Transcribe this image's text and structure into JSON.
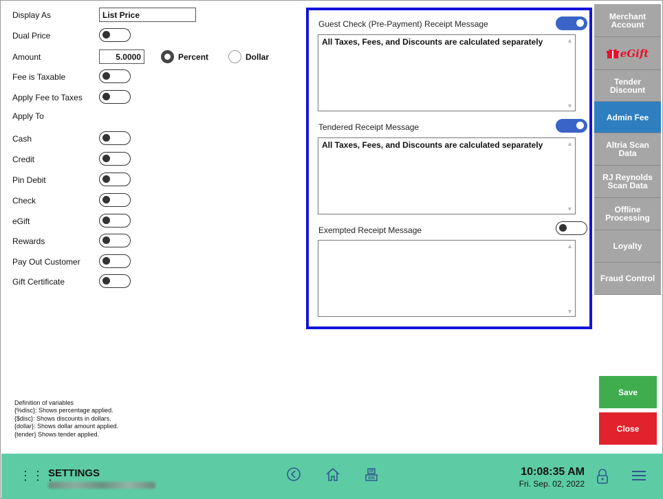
{
  "left": {
    "display_as": {
      "label": "Display As",
      "value": "List Price"
    },
    "dual_price": {
      "label": "Dual Price",
      "on": false
    },
    "amount": {
      "label": "Amount",
      "value": "5.0000",
      "percent_label": "Percent",
      "dollar_label": "Dollar",
      "selected": "percent"
    },
    "fee_taxable": {
      "label": "Fee is Taxable",
      "on": false
    },
    "apply_fee_taxes": {
      "label": "Apply Fee to Taxes",
      "on": false
    },
    "apply_to_label": "Apply To",
    "tenders": [
      {
        "label": "Cash",
        "on": false
      },
      {
        "label": "Credit",
        "on": false
      },
      {
        "label": "Pin Debit",
        "on": false
      },
      {
        "label": "Check",
        "on": false
      },
      {
        "label": "eGift",
        "on": false
      },
      {
        "label": "Rewards",
        "on": false
      },
      {
        "label": "Pay Out Customer",
        "on": false
      },
      {
        "label": "Gift Certificate",
        "on": false
      }
    ],
    "definitions": [
      "Definition of variables",
      "{%disc}: Shows percentage applied.",
      "{$disc}:  Shows discounts in dollars.",
      "{dollar}: Shows dollar amount applied.",
      "{tender} Shows tender applied."
    ]
  },
  "receipt": {
    "guest_check": {
      "title": "Guest Check (Pre-Payment) Receipt Message",
      "on": true,
      "text": "All Taxes, Fees, and Discounts are calculated separately"
    },
    "tendered": {
      "title": "Tendered Receipt Message",
      "on": true,
      "text": "All Taxes, Fees, and Discounts are calculated separately"
    },
    "exempted": {
      "title": "Exempted Receipt Message",
      "on": false,
      "text": ""
    }
  },
  "side_menu": {
    "merchant": "Merchant Account",
    "egift": "eGift",
    "tender_discount": "Tender Discount",
    "admin_fee": "Admin Fee",
    "altria": "Altria Scan Data",
    "rj": "RJ Reynolds Scan Data",
    "offline": "Offline Processing",
    "loyalty": "Loyalty",
    "fraud": "Fraud Control",
    "save": "Save",
    "close": "Close"
  },
  "footer": {
    "title": "SETTINGS",
    "time": "10:08:35 AM",
    "date": "Fri. Sep. 02, 2022"
  },
  "colors": {
    "accent_blue": "#2f7fc0",
    "panel_border": "#1414d8",
    "footer": "#5dcca5",
    "save": "#3fad4d",
    "close": "#e0232d"
  }
}
